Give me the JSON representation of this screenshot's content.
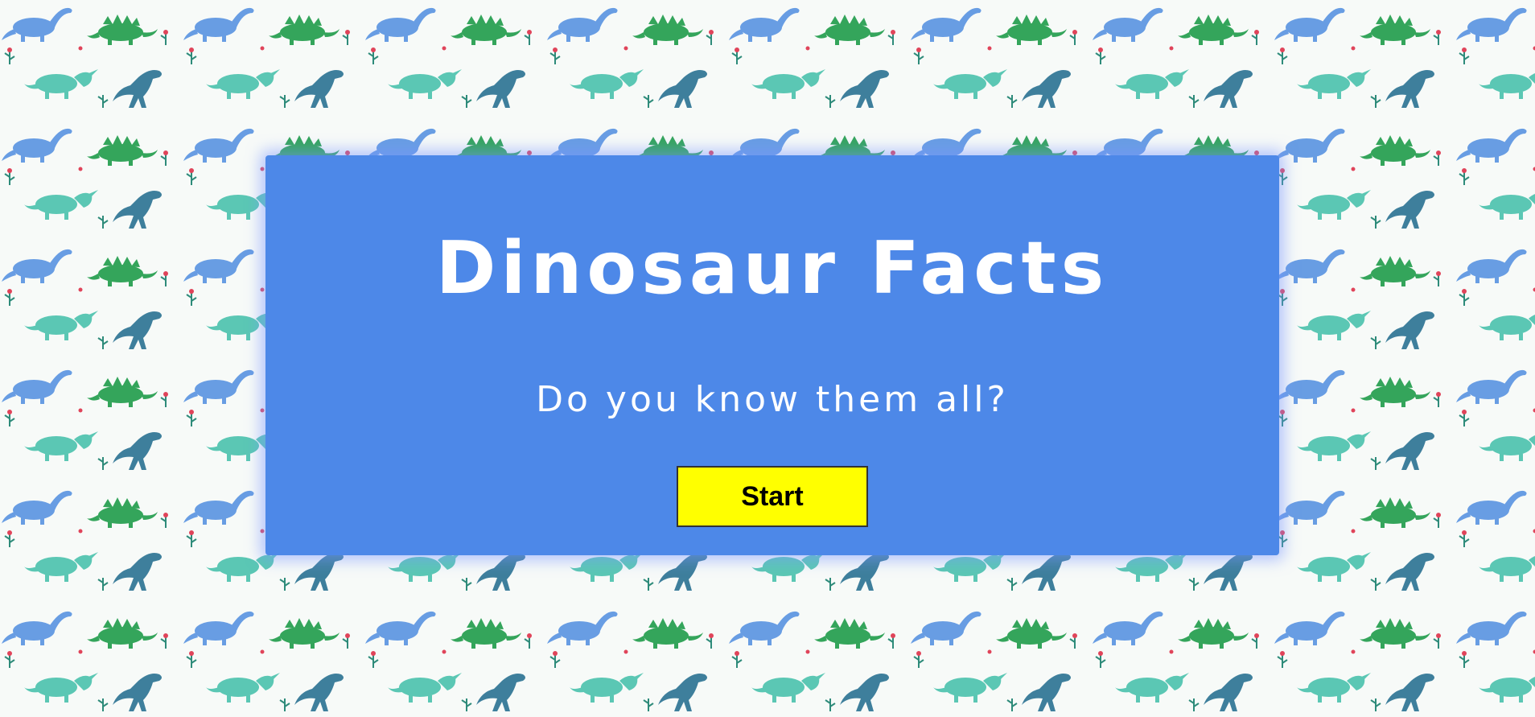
{
  "page": {
    "title": "Dinosaur Facts",
    "subtitle": "Do you know them all?",
    "start_label": "Start"
  },
  "colors": {
    "card": "#4d88e8",
    "button": "#ffff00",
    "text": "#ffffff"
  },
  "background": {
    "pattern": "watercolor-dinosaur-pattern"
  }
}
